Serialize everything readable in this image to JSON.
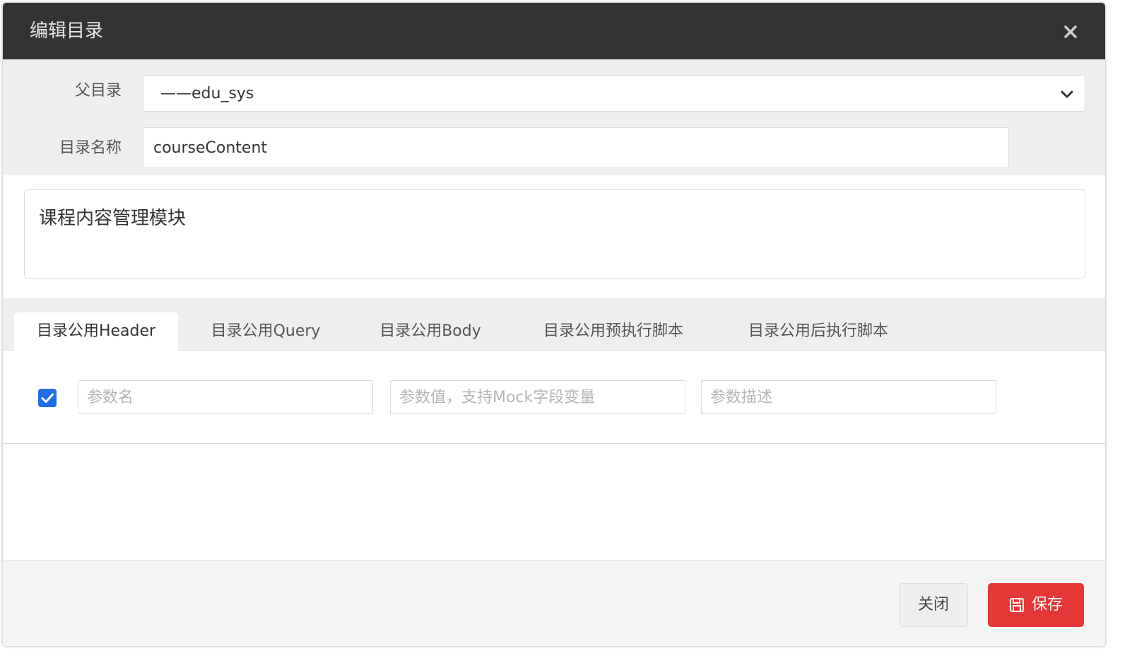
{
  "dialog": {
    "title": "编辑目录",
    "close_icon": "close-icon"
  },
  "form": {
    "parent_label": "父目录",
    "parent_value": "——edu_sys",
    "name_label": "目录名称",
    "name_value": "courseContent",
    "description_value": "课程内容管理模块"
  },
  "tabs": [
    {
      "label": "目录公用Header",
      "active": true
    },
    {
      "label": "目录公用Query",
      "active": false
    },
    {
      "label": "目录公用Body",
      "active": false
    },
    {
      "label": "目录公用预执行脚本",
      "active": false
    },
    {
      "label": "目录公用后执行脚本",
      "active": false
    }
  ],
  "params": {
    "checked": true,
    "name_placeholder": "参数名",
    "value_placeholder": "参数值，支持Mock字段变量",
    "desc_placeholder": "参数描述"
  },
  "footer": {
    "close_label": "关闭",
    "save_label": "保存"
  },
  "colors": {
    "titlebar": "#333333",
    "save_button": "#e43838",
    "checkbox": "#1e6fe8"
  }
}
